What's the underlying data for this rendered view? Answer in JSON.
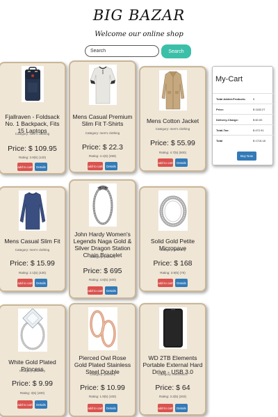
{
  "header": {
    "brand": "BIG BAZAR",
    "tagline": "Welcome our online shop",
    "search_placeholder": "Search",
    "search_button": "Search"
  },
  "products": [
    {
      "title": "Fjallraven - Foldsack No. 1 Backpack, Fits 15 Laptops",
      "category": "Category: men's clothing",
      "price": "Price: $ 109.95",
      "rating": "Rating: 3.9(5) (120)",
      "add_label": "add to cart",
      "details_label": "Details",
      "icon": "backpack-image"
    },
    {
      "title": "Mens Casual Premium Slim Fit T-Shirts",
      "category": "Category: men's clothing",
      "price": "Price: $ 22.3",
      "rating": "Rating: 4.1(5) (259)",
      "add_label": "add to cart",
      "details_label": "Details",
      "icon": "tshirt-image"
    },
    {
      "title": "Mens Cotton Jacket",
      "category": "Category: men's clothing",
      "price": "Price: $ 55.99",
      "rating": "Rating: 4.7(5) (500)",
      "add_label": "add to cart",
      "details_label": "Details",
      "icon": "jacket-image"
    },
    {
      "title": "Mens Casual Slim Fit",
      "category": "Category: men's clothing",
      "price": "Price: $ 15.99",
      "rating": "Rating: 2.1(5) (430)",
      "add_label": "add to cart",
      "details_label": "Details",
      "icon": "longsleeve-image"
    },
    {
      "title": "John Hardy Women's Legends Naga Gold & Silver Dragon Station Chain Bracelet",
      "category": "Category: jewelery",
      "price": "Price: $ 695",
      "rating": "Rating: 4.6(5) (400)",
      "add_label": "add to cart",
      "details_label": "Details",
      "icon": "bracelet-image"
    },
    {
      "title": "Solid Gold Petite Micropave",
      "category": "Category: jewelery",
      "price": "Price: $ 168",
      "rating": "Rating: 3.9(5) (70)",
      "add_label": "add to cart",
      "details_label": "Details",
      "icon": "ring-image"
    },
    {
      "title": "White Gold Plated Princess",
      "category": "Category: jewelery",
      "price": "Price: $ 9.99",
      "rating": "Rating: 3(5) (400)",
      "add_label": "add to cart",
      "details_label": "Details",
      "icon": "diamond-ring-image"
    },
    {
      "title": "Pierced Owl Rose Gold Plated Stainless Steel Double",
      "category": "Category: jewelery",
      "price": "Price: $ 10.99",
      "rating": "Rating: 1.9(5) (100)",
      "add_label": "add to cart",
      "details_label": "Details",
      "icon": "earrings-image"
    },
    {
      "title": "WD 2TB Elements Portable External Hard Drive - USB 3.0",
      "category": "Category: electronics",
      "price": "Price: $ 64",
      "rating": "Rating: 3.3(5) (203)",
      "add_label": "add to cart",
      "details_label": "Details",
      "icon": "hard-drive-image"
    }
  ],
  "cart": {
    "title": "My-Cart",
    "rows": [
      {
        "label": "Total Added-Products:",
        "value": "9"
      },
      {
        "label": "Price:",
        "value": "$ 1182.27"
      },
      {
        "label": "Delivery-Charge:",
        "value": "$ 60.00"
      },
      {
        "label": "Total-Tax:",
        "value": "$ 472.91"
      },
      {
        "label": "Total",
        "value": "$ 1715.18"
      }
    ],
    "buy_label": "Buy Now"
  },
  "colors": {
    "card_bg": "#f0e6d6",
    "search_button": "#3bbfa8",
    "add_button": "#d9534f",
    "details_button": "#337ab7"
  }
}
